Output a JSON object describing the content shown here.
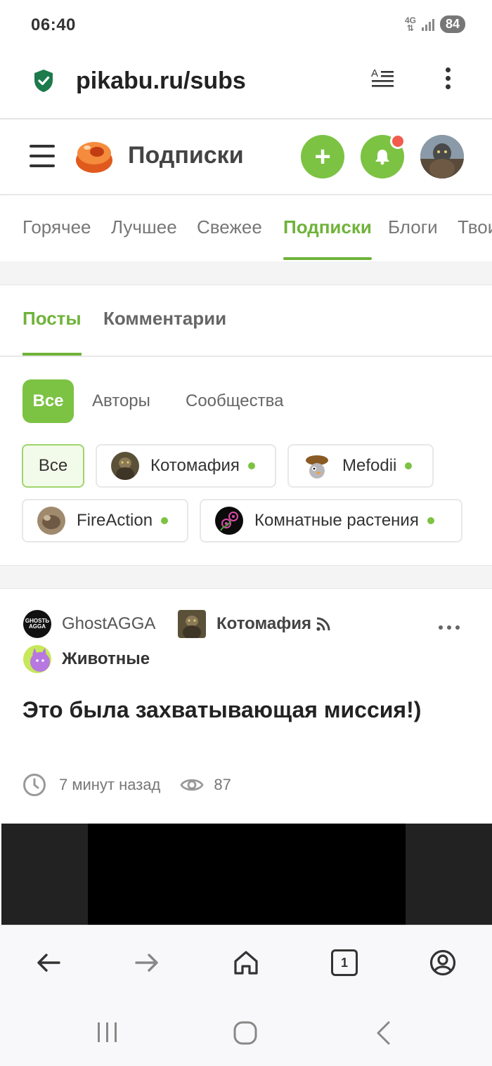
{
  "status_bar": {
    "time": "06:40",
    "network": "4G",
    "battery": "84"
  },
  "browser": {
    "url": "pikabu.ru/subs",
    "tabs_count": "1"
  },
  "header": {
    "title": "Подписки"
  },
  "main_nav": {
    "items": [
      {
        "label": "Горячее"
      },
      {
        "label": "Лучшее"
      },
      {
        "label": "Свежее"
      },
      {
        "label": "Подписки",
        "active": true
      },
      {
        "label": "Блоги"
      },
      {
        "label": "Твои"
      }
    ]
  },
  "content_tabs": {
    "posts": "Посты",
    "comments": "Комментарии"
  },
  "segment": {
    "all": "Все",
    "authors": "Авторы",
    "communities": "Сообщества"
  },
  "chips": {
    "all": "Все",
    "items": [
      {
        "label": "Котомафия"
      },
      {
        "label": "Mefodii"
      },
      {
        "label": "FireAction"
      },
      {
        "label": "Комнатные растения"
      }
    ]
  },
  "post": {
    "author": "GhostAGGA",
    "author_avatar_text": "GHOSTЬ AGGA",
    "community": "Котомафия",
    "tag": "Животные",
    "title": "Это была захватывающая миссия!)",
    "time": "7 минут назад",
    "views": "87"
  },
  "colors": {
    "accent": "#6fb33a",
    "button": "#7cc243",
    "notification": "#f25c4d"
  },
  "icons": [
    "shield-check-icon",
    "reader-mode-icon",
    "more-vertical-icon",
    "menu-icon",
    "plus-icon",
    "bell-icon",
    "rss-icon",
    "clock-icon",
    "eye-icon",
    "back-arrow-icon",
    "forward-arrow-icon",
    "home-icon",
    "account-icon"
  ]
}
